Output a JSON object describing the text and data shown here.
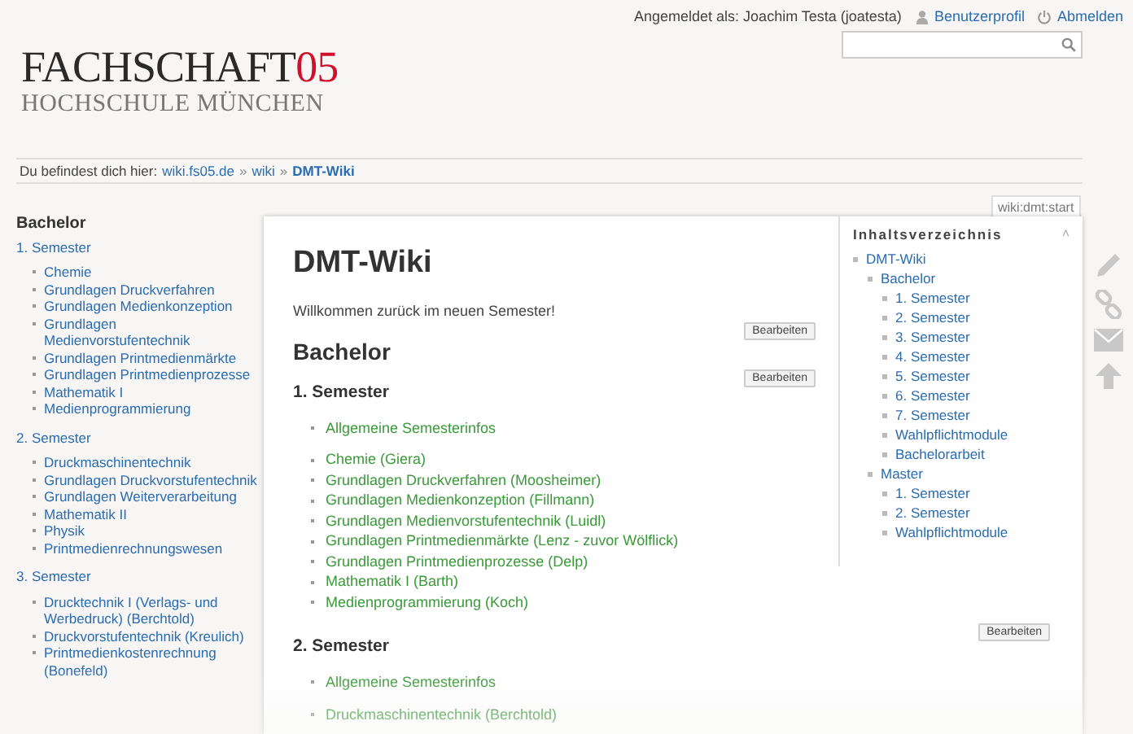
{
  "top_bar": {
    "logged_in": "Angemeldet als: Joachim Testa (joatesta)",
    "links": [
      {
        "kind": "profile",
        "label": "Benutzerprofil"
      },
      {
        "kind": "logout",
        "label": "Abmelden"
      }
    ]
  },
  "logo": {
    "name": "FACHSCHAFT",
    "number": "05",
    "subtitle": "HOCHSCHULE MÜNCHEN"
  },
  "breadcrumb": {
    "label": "Du befindest dich hier:",
    "links": [
      {
        "text": "wiki.fs05.de",
        "current": false
      },
      {
        "text": "wiki",
        "current": false
      },
      {
        "text": "DMT-Wiki",
        "current": true
      }
    ],
    "separator": "»"
  },
  "sidebar": {
    "heading": "Bachelor",
    "sections": [
      {
        "title": "1. Semester",
        "items": [
          "Chemie",
          "Grundlagen Druckverfahren",
          "Grundlagen Medienkonzeption",
          "Grundlagen Medienvorstufentechnik",
          "Grundlagen Printmedienmärkte",
          "Grundlagen Printmedienprozesse",
          "Mathematik I",
          "Medienprogrammierung"
        ]
      },
      {
        "title": "2. Semester",
        "items": [
          "Druckmaschinentechnik",
          "Grundlagen Druckvorstufentechnik",
          "Grundlagen Weiterverarbeitung",
          "Mathematik II",
          "Physik",
          "Printmedienrechnungswesen"
        ]
      },
      {
        "title": "3. Semester",
        "items": [
          "Drucktechnik I (Verlags- und Werbedruck) (Berchtold)",
          "Druckvorstufentechnik (Kreulich)",
          "Printmedienkostenrechnung (Bonefeld)"
        ]
      }
    ]
  },
  "page_id": "wiki:dmt:start",
  "toc": {
    "title": "Inhaltsverzeichnis",
    "toggle": "˄",
    "items": [
      {
        "label": "DMT-Wiki",
        "children": [
          {
            "label": "Bachelor",
            "children": [
              {
                "label": "1. Semester"
              },
              {
                "label": "2. Semester"
              },
              {
                "label": "3. Semester"
              },
              {
                "label": "4. Semester"
              },
              {
                "label": "5. Semester"
              },
              {
                "label": "6. Semester"
              },
              {
                "label": "7. Semester"
              },
              {
                "label": "Wahlpflichtmodule"
              },
              {
                "label": "Bachelorarbeit"
              }
            ]
          },
          {
            "label": "Master",
            "children": [
              {
                "label": "1. Semester"
              },
              {
                "label": "2. Semester"
              },
              {
                "label": "Wahlpflichtmodule"
              }
            ]
          }
        ]
      }
    ]
  },
  "content": [
    {
      "kind": "h1",
      "text": "DMT-Wiki"
    },
    {
      "kind": "paragraph",
      "text": "Willkommen zurück im neuen Semester!"
    },
    {
      "kind": "edit_button",
      "text": "Bearbeiten"
    },
    {
      "kind": "h2",
      "text": "Bachelor"
    },
    {
      "kind": "edit_button",
      "text": "Bearbeiten"
    },
    {
      "kind": "h3",
      "text": "1. Semester"
    },
    {
      "kind": "list",
      "items": [
        "Allgemeine Semesterinfos"
      ]
    },
    {
      "kind": "list",
      "items": [
        "Chemie (Giera)",
        "Grundlagen Druckverfahren (Moosheimer)",
        "Grundlagen Medienkonzeption (Fillmann)",
        "Grundlagen Medienvorstufentechnik (Luidl)",
        "Grundlagen Printmedienmärkte (Lenz - zuvor Wölflick)",
        "Grundlagen Printmedienprozesse (Delp)",
        "Mathematik I (Barth)",
        "Medienprogrammierung (Koch)"
      ]
    },
    {
      "kind": "edit_button",
      "text": "Bearbeiten"
    },
    {
      "kind": "h3",
      "text": "2. Semester"
    },
    {
      "kind": "list",
      "items": [
        "Allgemeine Semesterinfos"
      ]
    },
    {
      "kind": "list",
      "items": [
        "Druckmaschinentechnik (Berchtold)"
      ]
    }
  ]
}
